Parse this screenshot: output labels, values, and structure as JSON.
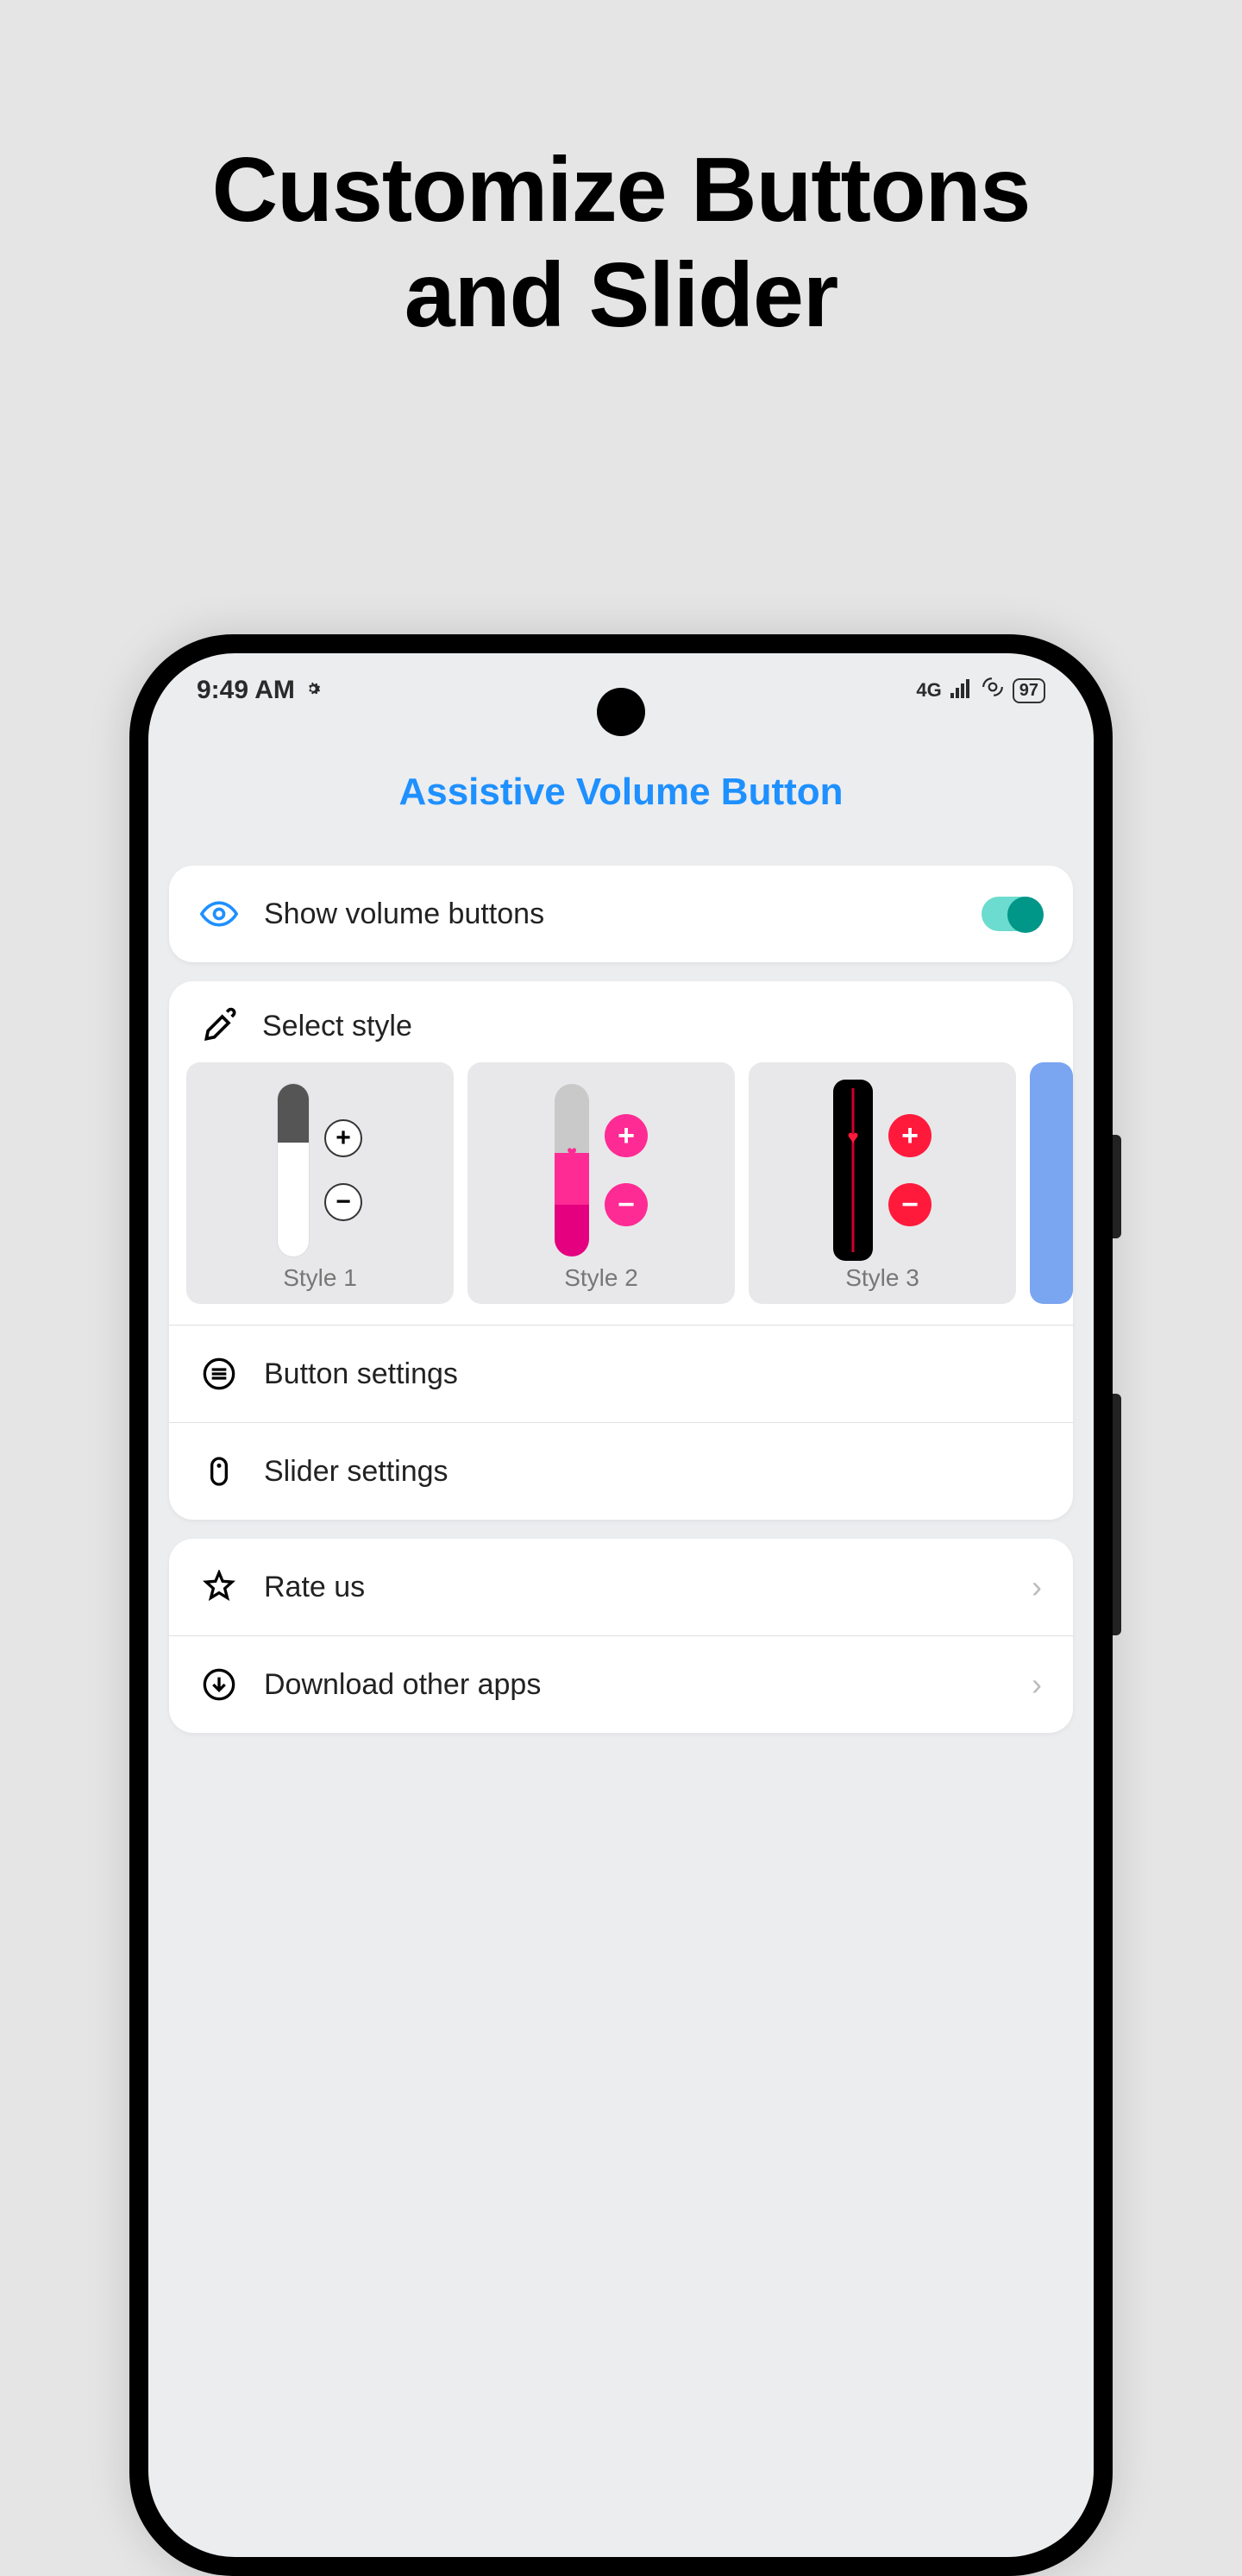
{
  "promo": {
    "line1": "Customize Buttons",
    "line2": "and Slider"
  },
  "statusbar": {
    "time": "9:49 AM",
    "network": "4G",
    "battery": "97"
  },
  "app_title": "Assistive Volume Button",
  "show_volume": {
    "label": "Show volume buttons",
    "enabled": true
  },
  "select_style": {
    "header": "Select style",
    "styles": [
      {
        "label": "Style 1"
      },
      {
        "label": "Style 2"
      },
      {
        "label": "Style 3"
      }
    ]
  },
  "button_settings": {
    "label": "Button settings"
  },
  "slider_settings": {
    "label": "Slider settings"
  },
  "rate_us": {
    "label": "Rate us"
  },
  "download_apps": {
    "label": "Download other apps"
  }
}
